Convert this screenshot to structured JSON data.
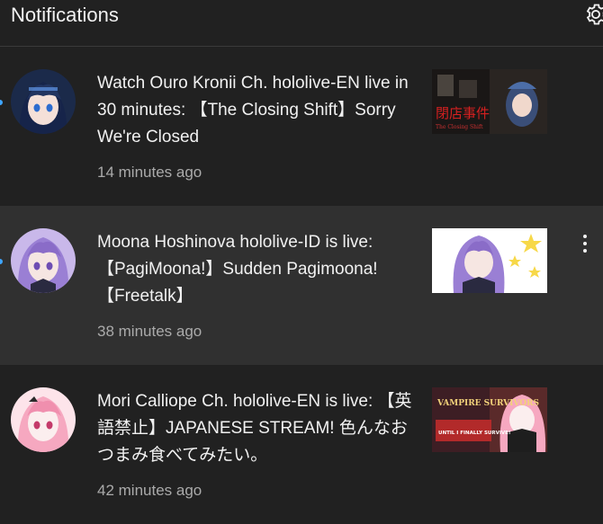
{
  "header": {
    "title": "Notifications",
    "settings_icon": "gear-icon"
  },
  "notifications": [
    {
      "message": "Watch Ouro Kronii Ch. hololive-EN live in 30 minutes: 【The Closing Shift】Sorry We're Closed",
      "time": "14 minutes ago",
      "unread": true,
      "thumbnail_caption": "閉店事件",
      "thumbnail_subcaption": "The Closing Shift"
    },
    {
      "message": "Moona Hoshinova hololive-ID is live: 【PagiMoona!】Sudden Pagimoona! 【Freetalk】",
      "time": "38 minutes ago",
      "unread": true
    },
    {
      "message": "Mori Calliope Ch. hololive-EN is live: 【英語禁止】JAPANESE STREAM! 色んなおつまみ食べてみたい。",
      "time": "42 minutes ago",
      "unread": false,
      "thumbnail_caption": "VAMPIRE SURVIVORS",
      "thumbnail_subcaption": "UNTIL I FINALLY SURVIVE!"
    }
  ],
  "colors": {
    "background": "#212121",
    "hover_row": "#303030",
    "unread_dot": "#3ea6ff",
    "time_text": "#aaaaaa"
  }
}
